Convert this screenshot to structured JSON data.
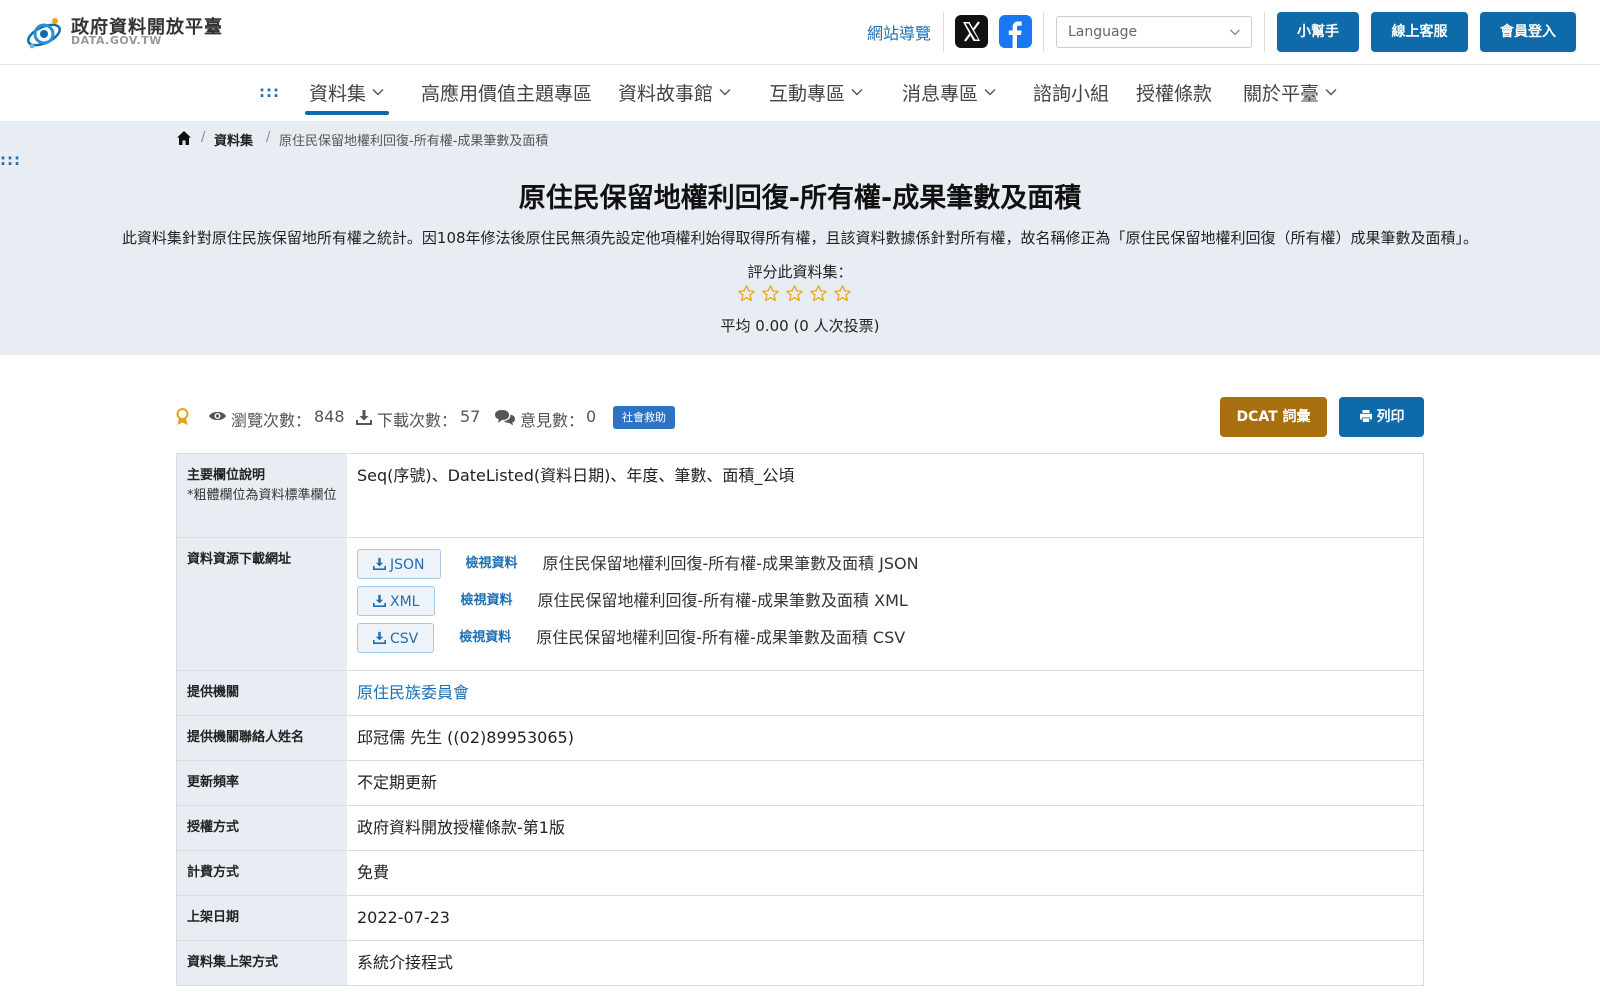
{
  "header": {
    "logo_name": "政府資料開放平臺",
    "logo_domain": "DATA.GOV.TW",
    "sitemap": "網站導覽",
    "language_placeholder": "Language",
    "buttons": {
      "helper": "小幫手",
      "support": "線上客服",
      "login": "會員登入"
    }
  },
  "nav": {
    "accesskey": ":::",
    "items": [
      {
        "label": "資料集",
        "dropdown": true,
        "active": true
      },
      {
        "label": "高應用價值主題專區",
        "dropdown": false
      },
      {
        "label": "資料故事館",
        "dropdown": true
      },
      {
        "label": "互動專區",
        "dropdown": true
      },
      {
        "label": "消息專區",
        "dropdown": true
      },
      {
        "label": "諮詢小組",
        "dropdown": false
      },
      {
        "label": "授權條款",
        "dropdown": false
      },
      {
        "label": "關於平臺",
        "dropdown": true
      }
    ]
  },
  "breadcrumb": {
    "home_icon": "home-icon",
    "items": [
      "資料集",
      "原住民保留地權利回復-所有權-成果筆數及面積"
    ]
  },
  "dataset": {
    "title": "原住民保留地權利回復-所有權-成果筆數及面積",
    "description": "此資料集針對原住民族保留地所有權之統計。因108年修法後原住民無須先設定他項權利始得取得所有權，且該資料數據係針對所有權，故名稱修正為「原住民保留地權利回復（所有權）成果筆數及面積」。",
    "rating_label": "評分此資料集：",
    "rating_stars": 0,
    "rating_max": 5,
    "rating_avg": "平均 0.00 (0 人次投票)"
  },
  "stats": {
    "views_label": "瀏覽次數：",
    "views": "848",
    "downloads_label": "下載次數：",
    "downloads": "57",
    "comments_label": "意見數：",
    "comments": "0",
    "tag": "社會救助",
    "dcat_button": "DCAT 詞彙",
    "print_button": "列印"
  },
  "meta": {
    "fields": {
      "label": "主要欄位說明",
      "note": "*粗體欄位為資料標準欄位",
      "value": "Seq(序號)、DateListed(資料日期)、年度、筆數、面積_公頃"
    },
    "resources": {
      "label": "資料資源下載網址",
      "items": [
        {
          "format": "JSON",
          "view": "檢視資料",
          "name": "原住民保留地權利回復-所有權-成果筆數及面積 JSON"
        },
        {
          "format": "XML",
          "view": "檢視資料",
          "name": "原住民保留地權利回復-所有權-成果筆數及面積 XML"
        },
        {
          "format": "CSV",
          "view": "檢視資料",
          "name": "原住民保留地權利回復-所有權-成果筆數及面積 CSV"
        }
      ]
    },
    "rows": [
      {
        "label": "提供機關",
        "value": "原住民族委員會",
        "link": true
      },
      {
        "label": "提供機關聯絡人姓名",
        "value": "邱冠儒 先生 ((02)89953065)"
      },
      {
        "label": "更新頻率",
        "value": "不定期更新"
      },
      {
        "label": "授權方式",
        "value": "政府資料開放授權條款-第1版"
      },
      {
        "label": "計費方式",
        "value": "免費"
      },
      {
        "label": "上架日期",
        "value": "2022-07-23"
      },
      {
        "label": "資料集上架方式",
        "value": "系統介接程式"
      }
    ]
  },
  "colors": {
    "primary": "#0e6aa8",
    "link": "#1e6fb2",
    "dcat": "#a86f0f",
    "hero_bg": "#e8edf3",
    "star": "#e8a317",
    "tag": "#2e72c4"
  }
}
